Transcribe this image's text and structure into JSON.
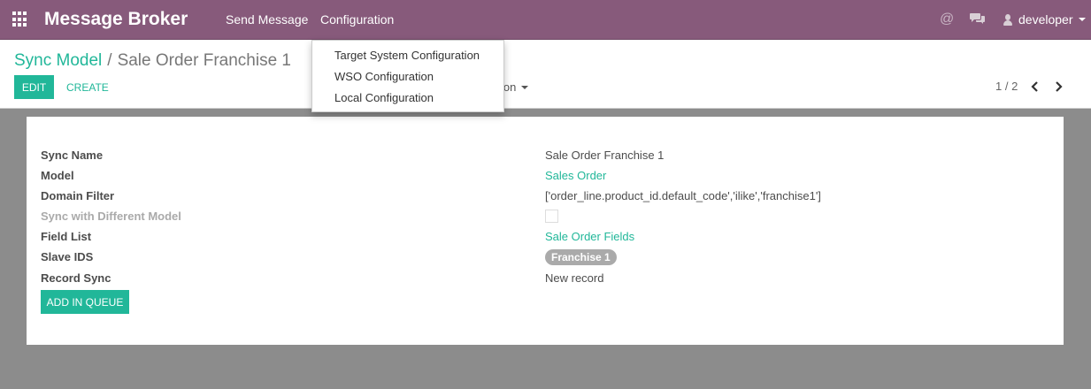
{
  "navbar": {
    "app_title": "Message Broker",
    "menu": [
      "Send Message",
      "Configuration"
    ],
    "icons": [
      "apps-grid-icon",
      "at-icon",
      "chat-icon",
      "user-icon"
    ],
    "at_symbol": "@",
    "user": "developer",
    "bg_color": "#875a7b"
  },
  "breadcrumb": {
    "parent": "Sync Model",
    "separator": "/",
    "current": "Sale Order Franchise 1"
  },
  "buttons": {
    "edit": "EDIT",
    "create": "CREATE",
    "action_partial": "ion",
    "add_in_queue": "ADD IN QUEUE"
  },
  "pager": {
    "value": "1 / 2"
  },
  "dropdown": {
    "items": [
      "Target System Configuration",
      "WSO Configuration",
      "Local Configuration"
    ]
  },
  "form": {
    "labels": {
      "sync_name": "Sync Name",
      "model": "Model",
      "domain_filter": "Domain Filter",
      "sync_different": "Sync with Different Model",
      "field_list": "Field List",
      "slave_ids": "Slave IDS",
      "record_sync": "Record Sync"
    },
    "values": {
      "sync_name": "Sale Order Franchise 1",
      "model": "Sales Order",
      "domain_filter": "['order_line.product_id.default_code','ilike','franchise1']",
      "field_list": "Sale Order Fields",
      "slave_tag": "Franchise 1",
      "record_sync": "New record"
    }
  },
  "colors": {
    "accent": "#21b799",
    "background": "#8c8c8c",
    "tag": "#aaaaaa"
  }
}
